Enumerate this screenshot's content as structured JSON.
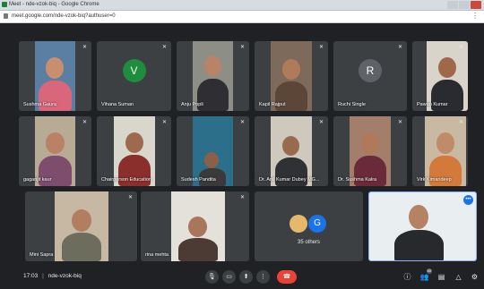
{
  "window": {
    "title": "Meet - nde-vzok-biq - Google Chrome"
  },
  "address_bar": {
    "url": "meet.google.com/nde-vzok-biq?authuser=0"
  },
  "participants": [
    {
      "name": "Sushma Gaura"
    },
    {
      "name": "Vihana Suman",
      "avatar_letter": "V",
      "avatar_color": "#1e8e3e"
    },
    {
      "name": "Anju Popli"
    },
    {
      "name": "Kapil Rajput"
    },
    {
      "name": "Ruchi Single",
      "avatar_letter": "R",
      "avatar_color": "#5f6368"
    },
    {
      "name": "Pawan Kumar"
    },
    {
      "name": "gaganjit kaur"
    },
    {
      "name": "Chairperson Education"
    },
    {
      "name": "Sudesh Pandita"
    },
    {
      "name": "Dr. Anil Kumar Dubey MG..."
    },
    {
      "name": "Dr. Sushma Kalra"
    },
    {
      "name": "Virk Kimandeep"
    },
    {
      "name": "Mini Sapra"
    },
    {
      "name": "rina mehta"
    }
  ],
  "others_tile": {
    "label": "35 others",
    "avatar_letter": "G",
    "avatar_color": "#1a73e8"
  },
  "self_tile": {
    "menu_glyph": "•••"
  },
  "bottom_bar": {
    "time": "17:03",
    "separator": "|",
    "meeting_code": "nde-vzok-biq",
    "participant_count": "50"
  },
  "colors": {
    "background": "#202124",
    "tile": "#3c4043",
    "end_call": "#ea4335",
    "accent": "#1a73e8"
  },
  "icons": {
    "mic": "mic-icon",
    "camera": "camera-icon",
    "present": "present-screen-icon",
    "more": "more-options-icon",
    "end_call": "end-call-icon",
    "info": "info-icon",
    "people": "people-icon",
    "chat": "chat-icon",
    "activities": "activities-icon",
    "host_controls": "host-controls-icon"
  }
}
